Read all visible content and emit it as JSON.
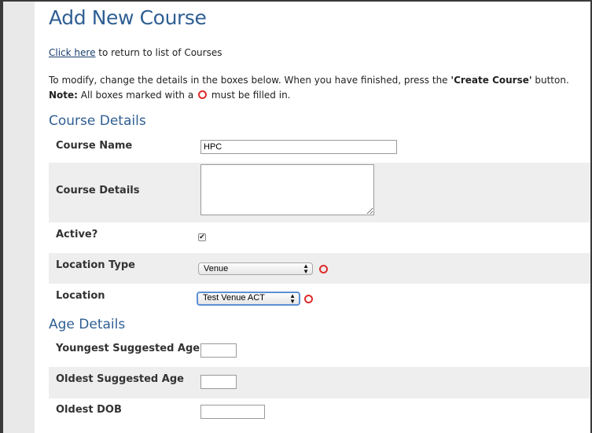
{
  "page": {
    "title": "Add New Course",
    "return_link": "Click here",
    "return_text": " to return to list of Courses",
    "instr_1": "To modify, change the details in the boxes below. When you have finished, press the ",
    "instr_button": "'Create Course'",
    "instr_2": " button.",
    "note_label": "Note:",
    "note_1": " All boxes marked with a ",
    "note_2": " must be filled in."
  },
  "course_details": {
    "heading": "Course Details",
    "course_name": {
      "label": "Course Name",
      "value": "HPC"
    },
    "course_desc": {
      "label": "Course Details",
      "value": ""
    },
    "active": {
      "label": "Active?",
      "checked": true,
      "mark": "✔"
    },
    "location_type": {
      "label": "Location Type",
      "value": "Venue"
    },
    "location": {
      "label": "Location",
      "value": "Test Venue ACT"
    }
  },
  "age_details": {
    "heading": "Age Details",
    "youngest": {
      "label": "Youngest Suggested Age",
      "value": ""
    },
    "oldest": {
      "label": "Oldest Suggested Age",
      "value": ""
    },
    "oldest_dob": {
      "label": "Oldest DOB",
      "value": ""
    }
  },
  "colors": {
    "title": "#2f5f93",
    "link": "#1a3d6d",
    "required": "#e02b2b",
    "alt_row": "#eeeeee",
    "sidebar": "#e9e9e9"
  }
}
